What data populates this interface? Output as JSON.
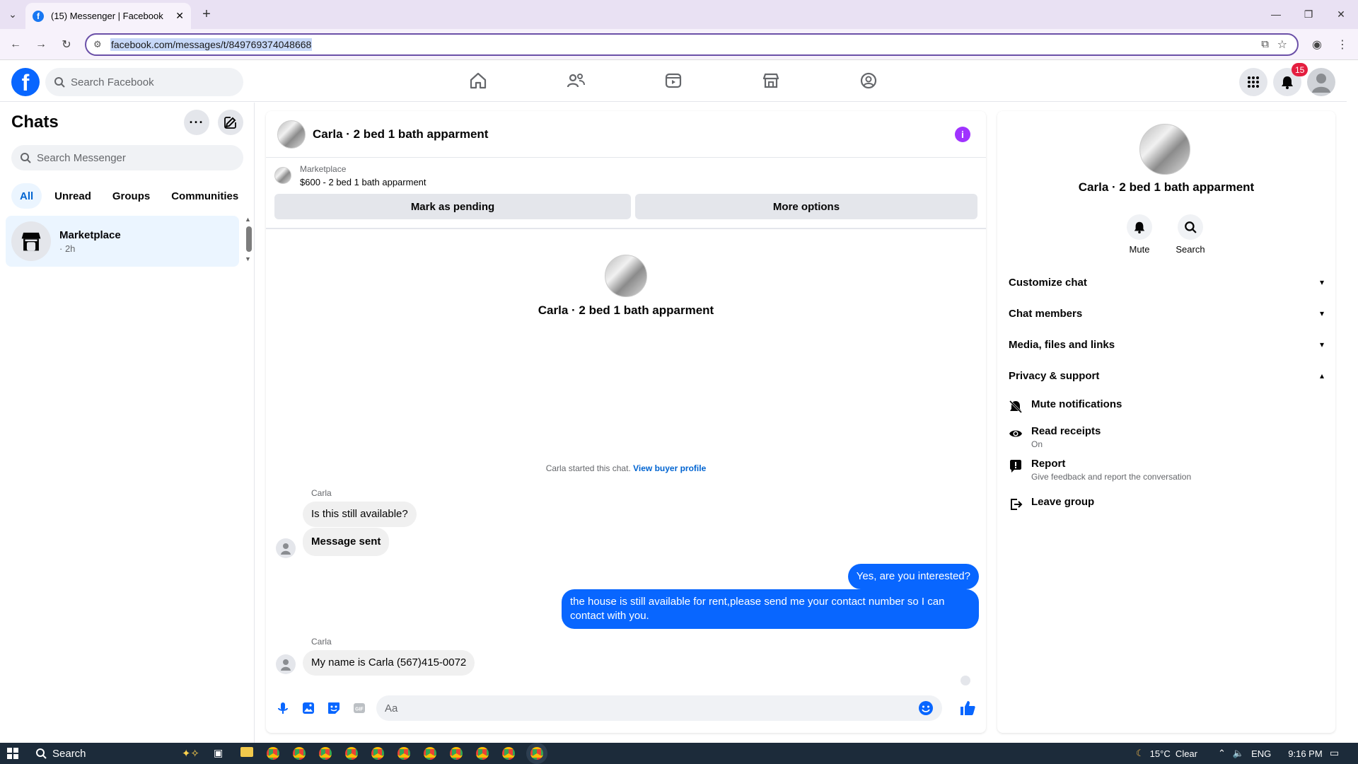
{
  "browser": {
    "tab_title": "(15) Messenger | Facebook",
    "url": "facebook.com/messages/t/849769374048668"
  },
  "fb": {
    "search_placeholder": "Search Facebook",
    "notifications_count": "15"
  },
  "chats": {
    "title": "Chats",
    "search_placeholder": "Search Messenger",
    "filters": [
      "All",
      "Unread",
      "Groups",
      "Communities"
    ],
    "active_filter": "All",
    "items": [
      {
        "name": "Marketplace",
        "time": "· 2h"
      }
    ]
  },
  "conversation": {
    "title": "Carla · 2 bed 1 bath apparment",
    "listing_label": "Marketplace",
    "listing_price": "$600 - 2 bed 1 bath apparment",
    "mark_pending": "Mark as pending",
    "more_options": "More options",
    "intro_name": "Carla · 2 bed 1 bath apparment",
    "started_text": "Carla started this chat.",
    "view_buyer": "View buyer profile",
    "messages": [
      {
        "sender": "Carla",
        "text": "Is this still available?"
      },
      {
        "text": "Message sent"
      },
      {
        "text": "Yes, are you interested?"
      },
      {
        "text": "the house is still available for rent,please send me your contact number so I can contact with you."
      },
      {
        "sender": "Carla",
        "text": "My name is Carla (567)415-0072"
      }
    ],
    "input_placeholder": "Aa"
  },
  "info": {
    "name": "Carla · 2 bed 1 bath apparment",
    "actions": {
      "mute": "Mute",
      "search": "Search"
    },
    "sections": {
      "customize": "Customize chat",
      "members": "Chat members",
      "media": "Media, files and links",
      "privacy": "Privacy & support"
    },
    "privacy_items": {
      "mute_title": "Mute notifications",
      "read_title": "Read receipts",
      "read_sub": "On",
      "report_title": "Report",
      "report_sub": "Give feedback and report the conversation",
      "leave_title": "Leave group"
    }
  },
  "taskbar": {
    "search": "Search",
    "weather": "15°C  Clear",
    "lang": "ENG",
    "time": "9:16 PM"
  },
  "colors": {
    "accent": "#0866ff",
    "brand": "#0866ff",
    "info_icon": "#a033ff",
    "badge": "#e41e3f"
  }
}
